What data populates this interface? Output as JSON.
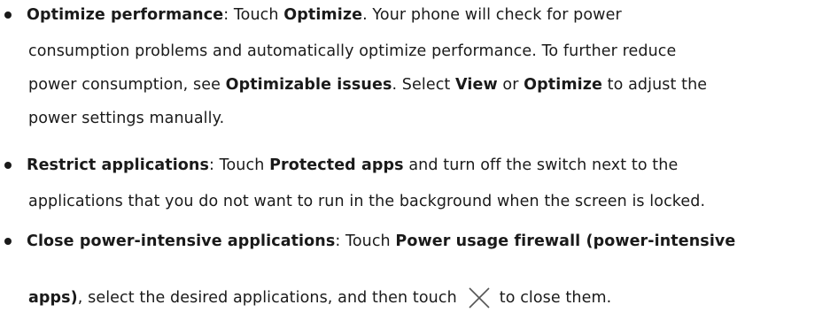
{
  "items": [
    {
      "term": "Optimize performance",
      "l1_a": ": Touch ",
      "l1_b": "Optimize",
      "l1_c": ". Your phone will check for power",
      "l2": "consumption problems and automatically optimize performance. To further reduce",
      "l3_a": "power consumption, see ",
      "l3_b": "Optimizable issues",
      "l3_c": ". Select ",
      "l3_d": "View",
      "l3_e": " or ",
      "l3_f": "Optimize",
      "l3_g": " to adjust the",
      "l4": "power settings manually."
    },
    {
      "term": "Restrict applications",
      "l1_a": ": Touch ",
      "l1_b": "Protected apps",
      "l1_c": " and turn off the switch next to the",
      "l2": "applications that you do not want to run in the background when the screen is locked."
    },
    {
      "term": "Close power-intensive applications",
      "l1_a": ": Touch ",
      "l1_b": "Power usage firewall (power-intensive",
      "l2_a": "apps)",
      "l2_b": ", select the desired applications, and then touch",
      "l2_c": "to close them.",
      "icon": "close-icon"
    }
  ]
}
